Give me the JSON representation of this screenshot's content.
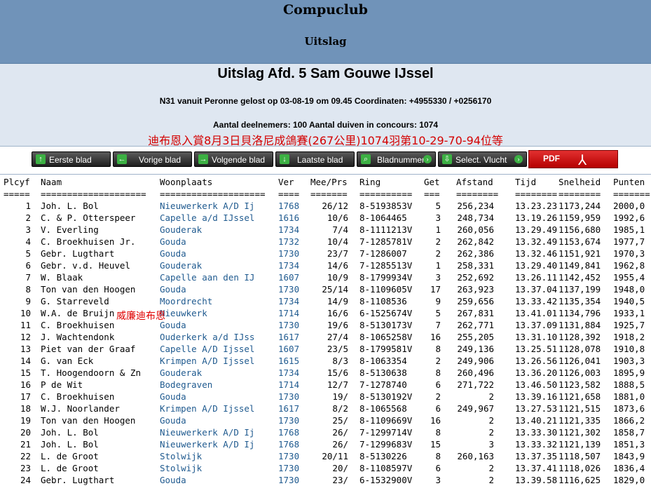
{
  "header": {
    "site": "Compuclub",
    "subtitle": "Uitslag"
  },
  "info": {
    "title": "Uitslag Afd. 5 Sam Gouwe IJssel",
    "flight": "N31 vanuit Peronne gelost op 03-08-19 om 09.45 Coordinaten: +4955330 / +0256170",
    "counts": "Aantal deelnemers: 100 Aantal duiven in concours: 1074",
    "chinese": "迪布恩入賞8月3日貝洛尼成鴿賽(267公里)1074羽第10-29-70-94位等",
    "overlay": "威廉迪布恩"
  },
  "buttons": [
    {
      "label": "Eerste blad",
      "icon": "arrow-up-icon"
    },
    {
      "label": "Vorige blad",
      "icon": "arrow-left-icon"
    },
    {
      "label": "Volgende blad",
      "icon": "arrow-right-icon"
    },
    {
      "label": "Laatste blad",
      "icon": "arrow-down-icon"
    },
    {
      "label": "Bladnummer",
      "icon": "search-icon"
    },
    {
      "label": "Select. Vlucht",
      "icon": "download-icon"
    }
  ],
  "pdf": {
    "label": "PDF"
  },
  "columns": [
    "Plcyf",
    "Naam",
    "Woonplaats",
    "Ver",
    "Mee/Prs",
    "Ring",
    "Get",
    "Afstand",
    "Tijd",
    "Snelheid",
    "Punten"
  ],
  "separators": [
    "=====",
    "====================",
    "====================",
    "====",
    "=======",
    "==========",
    "===",
    "========",
    "========",
    "========",
    "======="
  ],
  "rows": [
    [
      "1",
      "Joh. L. Bol",
      "Nieuwerkerk A/D Ij",
      "1768",
      "26/12",
      "8-5193853V",
      "5",
      "256,234",
      "13.23.23",
      "1173,244",
      "2000,0"
    ],
    [
      "2",
      "C. & P. Otterspeer",
      "Capelle a/d IJssel",
      "1616",
      "10/6",
      "8-1064465",
      "3",
      "248,734",
      "13.19.26",
      "1159,959",
      "1992,6"
    ],
    [
      "3",
      "V. Everling",
      "Gouderak",
      "1734",
      "7/4",
      "8-1111213V",
      "1",
      "260,056",
      "13.29.49",
      "1156,680",
      "1985,1"
    ],
    [
      "4",
      "C. Broekhuisen Jr.",
      "Gouda",
      "1732",
      "10/4",
      "7-1285781V",
      "2",
      "262,842",
      "13.32.49",
      "1153,674",
      "1977,7"
    ],
    [
      "5",
      "Gebr. Lugthart",
      "Gouda",
      "1730",
      "23/7",
      "7-1286007",
      "2",
      "262,386",
      "13.32.46",
      "1151,921",
      "1970,3"
    ],
    [
      "6",
      "Gebr. v.d. Heuvel",
      "Gouderak",
      "1734",
      "14/6",
      "7-1285513V",
      "1",
      "258,331",
      "13.29.40",
      "1149,841",
      "1962,8"
    ],
    [
      "7",
      "W. Blaak",
      "Capelle aan den IJ",
      "1607",
      "10/9",
      "8-1799934V",
      "3",
      "252,692",
      "13.26.11",
      "1142,452",
      "1955,4"
    ],
    [
      "8",
      "Ton van den Hoogen",
      "Gouda",
      "1730",
      "25/14",
      "8-1109605V",
      "17",
      "263,923",
      "13.37.04",
      "1137,199",
      "1948,0"
    ],
    [
      "9",
      "G. Starreveld",
      "Moordrecht",
      "1734",
      "14/9",
      "8-1108536",
      "9",
      "259,656",
      "13.33.42",
      "1135,354",
      "1940,5"
    ],
    [
      "10",
      "W.A. de Bruijn",
      "Nieuwkerk",
      "1714",
      "16/6",
      "6-1525674V",
      "5",
      "267,831",
      "13.41.01",
      "1134,796",
      "1933,1"
    ],
    [
      "11",
      "C. Broekhuisen",
      "Gouda",
      "1730",
      "19/6",
      "8-5130173V",
      "7",
      "262,771",
      "13.37.09",
      "1131,884",
      "1925,7"
    ],
    [
      "12",
      "J. Wachtendonk",
      "Ouderkerk a/d IJss",
      "1617",
      "27/4",
      "8-1065258V",
      "16",
      "255,205",
      "13.31.10",
      "1128,392",
      "1918,2"
    ],
    [
      "13",
      "Piet van der Graaf",
      "Capelle A/D Ijssel",
      "1607",
      "23/5",
      "8-1799581V",
      "8",
      "249,136",
      "13.25.51",
      "1128,078",
      "1910,8"
    ],
    [
      "14",
      "G. van Eck",
      "Krimpen A/D Ijssel",
      "1615",
      "8/3",
      "8-1063354",
      "2",
      "249,906",
      "13.26.56",
      "1126,041",
      "1903,3"
    ],
    [
      "15",
      "T. Hoogendoorn & Zn",
      "Gouderak",
      "1734",
      "15/6",
      "8-5130638",
      "8",
      "260,496",
      "13.36.20",
      "1126,003",
      "1895,9"
    ],
    [
      "16",
      "P de Wit",
      "Bodegraven",
      "1714",
      "12/7",
      "7-1278740",
      "6",
      "271,722",
      "13.46.50",
      "1123,582",
      "1888,5"
    ],
    [
      "17",
      "C. Broekhuisen",
      "Gouda",
      "1730",
      "19/",
      "8-5130192V",
      "2",
      "2",
      "13.39.16",
      "1121,658",
      "1881,0"
    ],
    [
      "18",
      "W.J. Noorlander",
      "Krimpen A/D Ijssel",
      "1617",
      "8/2",
      "8-1065568",
      "6",
      "249,967",
      "13.27.53",
      "1121,515",
      "1873,6"
    ],
    [
      "19",
      "Ton van den Hoogen",
      "Gouda",
      "1730",
      "25/",
      "8-1109669V",
      "16",
      "2",
      "13.40.21",
      "1121,335",
      "1866,2"
    ],
    [
      "20",
      "Joh. L. Bol",
      "Nieuwerkerk A/D Ij",
      "1768",
      "26/",
      "7-1299714V",
      "8",
      "2",
      "13.33.30",
      "1121,302",
      "1858,7"
    ],
    [
      "21",
      "Joh. L. Bol",
      "Nieuwerkerk A/D Ij",
      "1768",
      "26/",
      "7-1299683V",
      "15",
      "3",
      "13.33.32",
      "1121,139",
      "1851,3"
    ],
    [
      "22",
      "L. de Groot",
      "Stolwijk",
      "1730",
      "20/11",
      "8-5130226",
      "8",
      "260,163",
      "13.37.35",
      "1118,507",
      "1843,9"
    ],
    [
      "23",
      "L. de Groot",
      "Stolwijk",
      "1730",
      "20/",
      "8-1108597V",
      "6",
      "2",
      "13.37.41",
      "1118,026",
      "1836,4"
    ],
    [
      "24",
      "Gebr. Lugthart",
      "Gouda",
      "1730",
      "23/",
      "6-1532900V",
      "3",
      "2",
      "13.39.58",
      "1116,625",
      "1829,0"
    ]
  ]
}
